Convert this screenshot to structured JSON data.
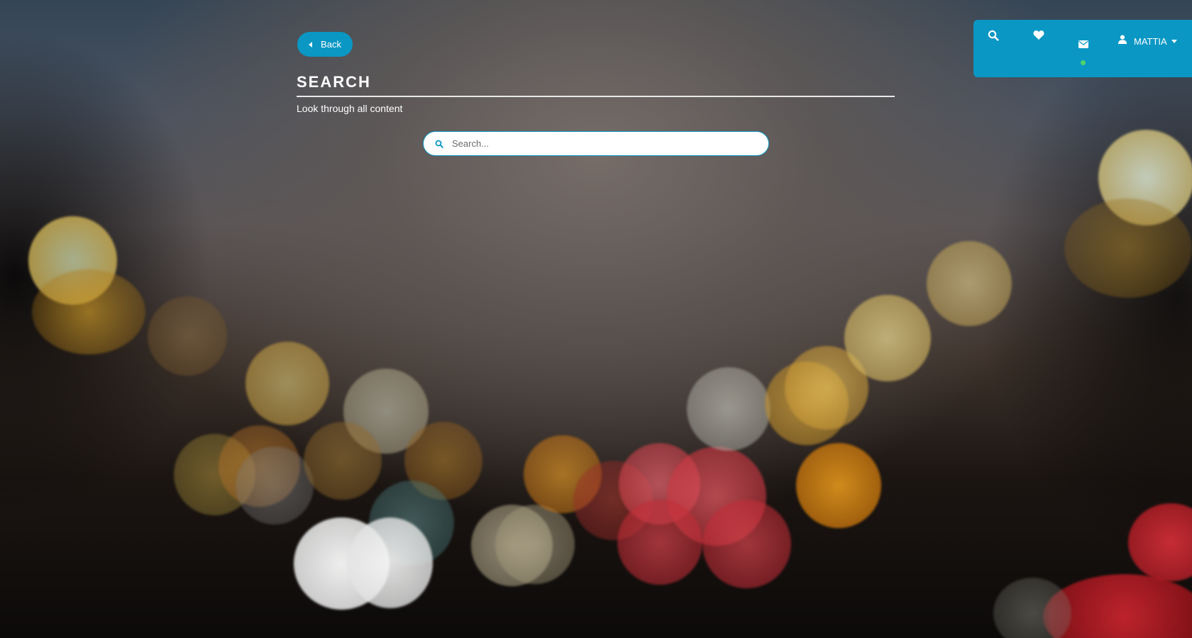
{
  "navigation": {
    "back_label": "Back"
  },
  "header": {
    "title": "SEARCH",
    "subtitle": "Look through all content"
  },
  "search": {
    "placeholder": "Search..."
  },
  "topbar": {
    "user_name": "MATTIA",
    "icons": [
      "search-icon",
      "heart-icon",
      "envelope-icon",
      "user-icon"
    ],
    "has_unread_messages": true
  },
  "colors": {
    "accent": "#0a97c4",
    "notification_dot": "#4fd36b",
    "text": "#ffffff"
  }
}
